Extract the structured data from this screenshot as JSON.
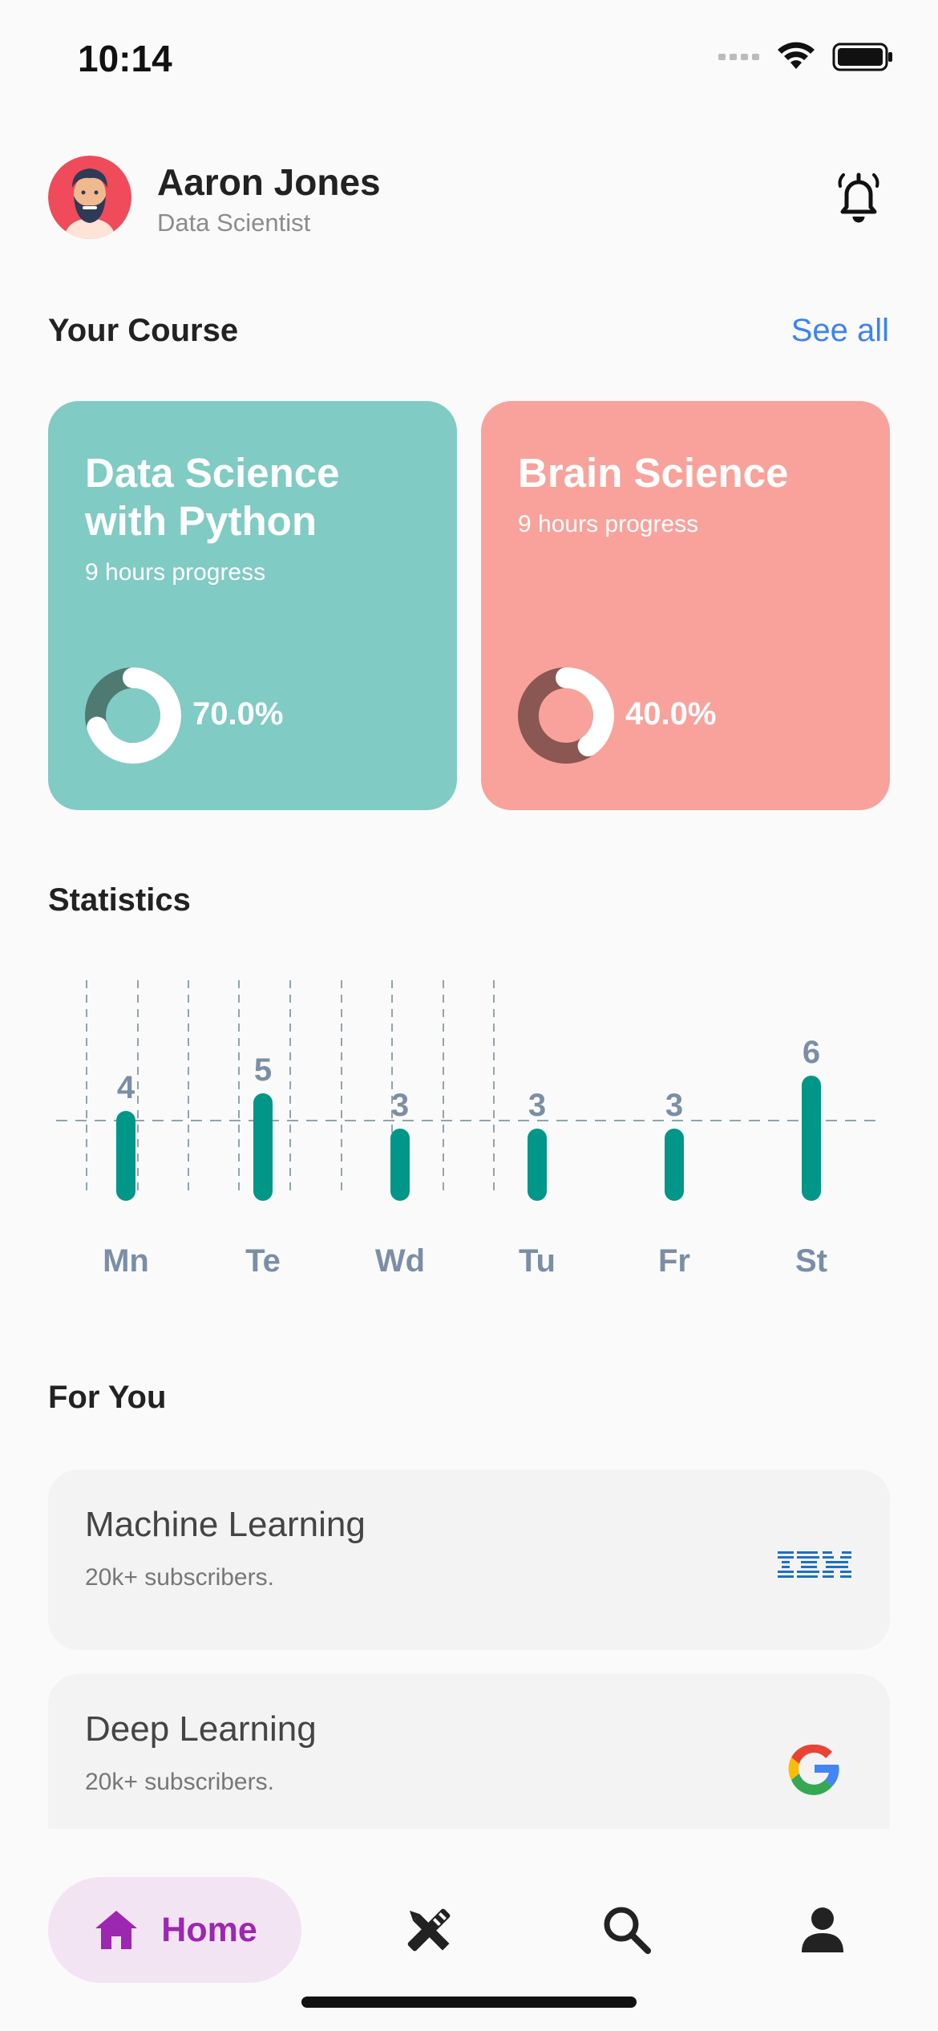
{
  "status_bar": {
    "time": "10:14"
  },
  "profile": {
    "name": "Aaron Jones",
    "role": "Data Scientist"
  },
  "your_course": {
    "title": "Your Course",
    "see_all": "See all",
    "cards": [
      {
        "title": "Data Science with Python",
        "subtitle": "9 hours progress",
        "progress": 0.7,
        "progress_label": "70.0%",
        "color": "#80cbc4",
        "ring_track": "#4e7a72"
      },
      {
        "title": "Brain Science",
        "subtitle": "9 hours progress",
        "progress": 0.4,
        "progress_label": "40.0%",
        "color": "#f8a29b",
        "ring_track": "#8a5752"
      }
    ]
  },
  "statistics": {
    "title": "Statistics",
    "chart_data": {
      "type": "bar",
      "categories": [
        "Mn",
        "Te",
        "Wd",
        "Tu",
        "Fr",
        "St"
      ],
      "values": [
        4,
        5,
        3,
        3,
        3,
        6
      ],
      "title": "",
      "xlabel": "",
      "ylabel": "",
      "ylim": [
        0,
        6
      ],
      "bar_color": "#009688",
      "label_color": "#7b8ea6",
      "grid": true
    }
  },
  "for_you": {
    "title": "For You",
    "items": [
      {
        "title": "Machine Learning",
        "subtitle": "20k+ subscribers.",
        "logo": "ibm-logo"
      },
      {
        "title": "Deep Learning",
        "subtitle": "20k+ subscribers.",
        "logo": "google-logo"
      }
    ]
  },
  "bottom_nav": {
    "home_label": "Home",
    "accent": "#9c27b0",
    "items": [
      "home-icon",
      "tools-icon",
      "search-icon",
      "profile-icon"
    ]
  }
}
